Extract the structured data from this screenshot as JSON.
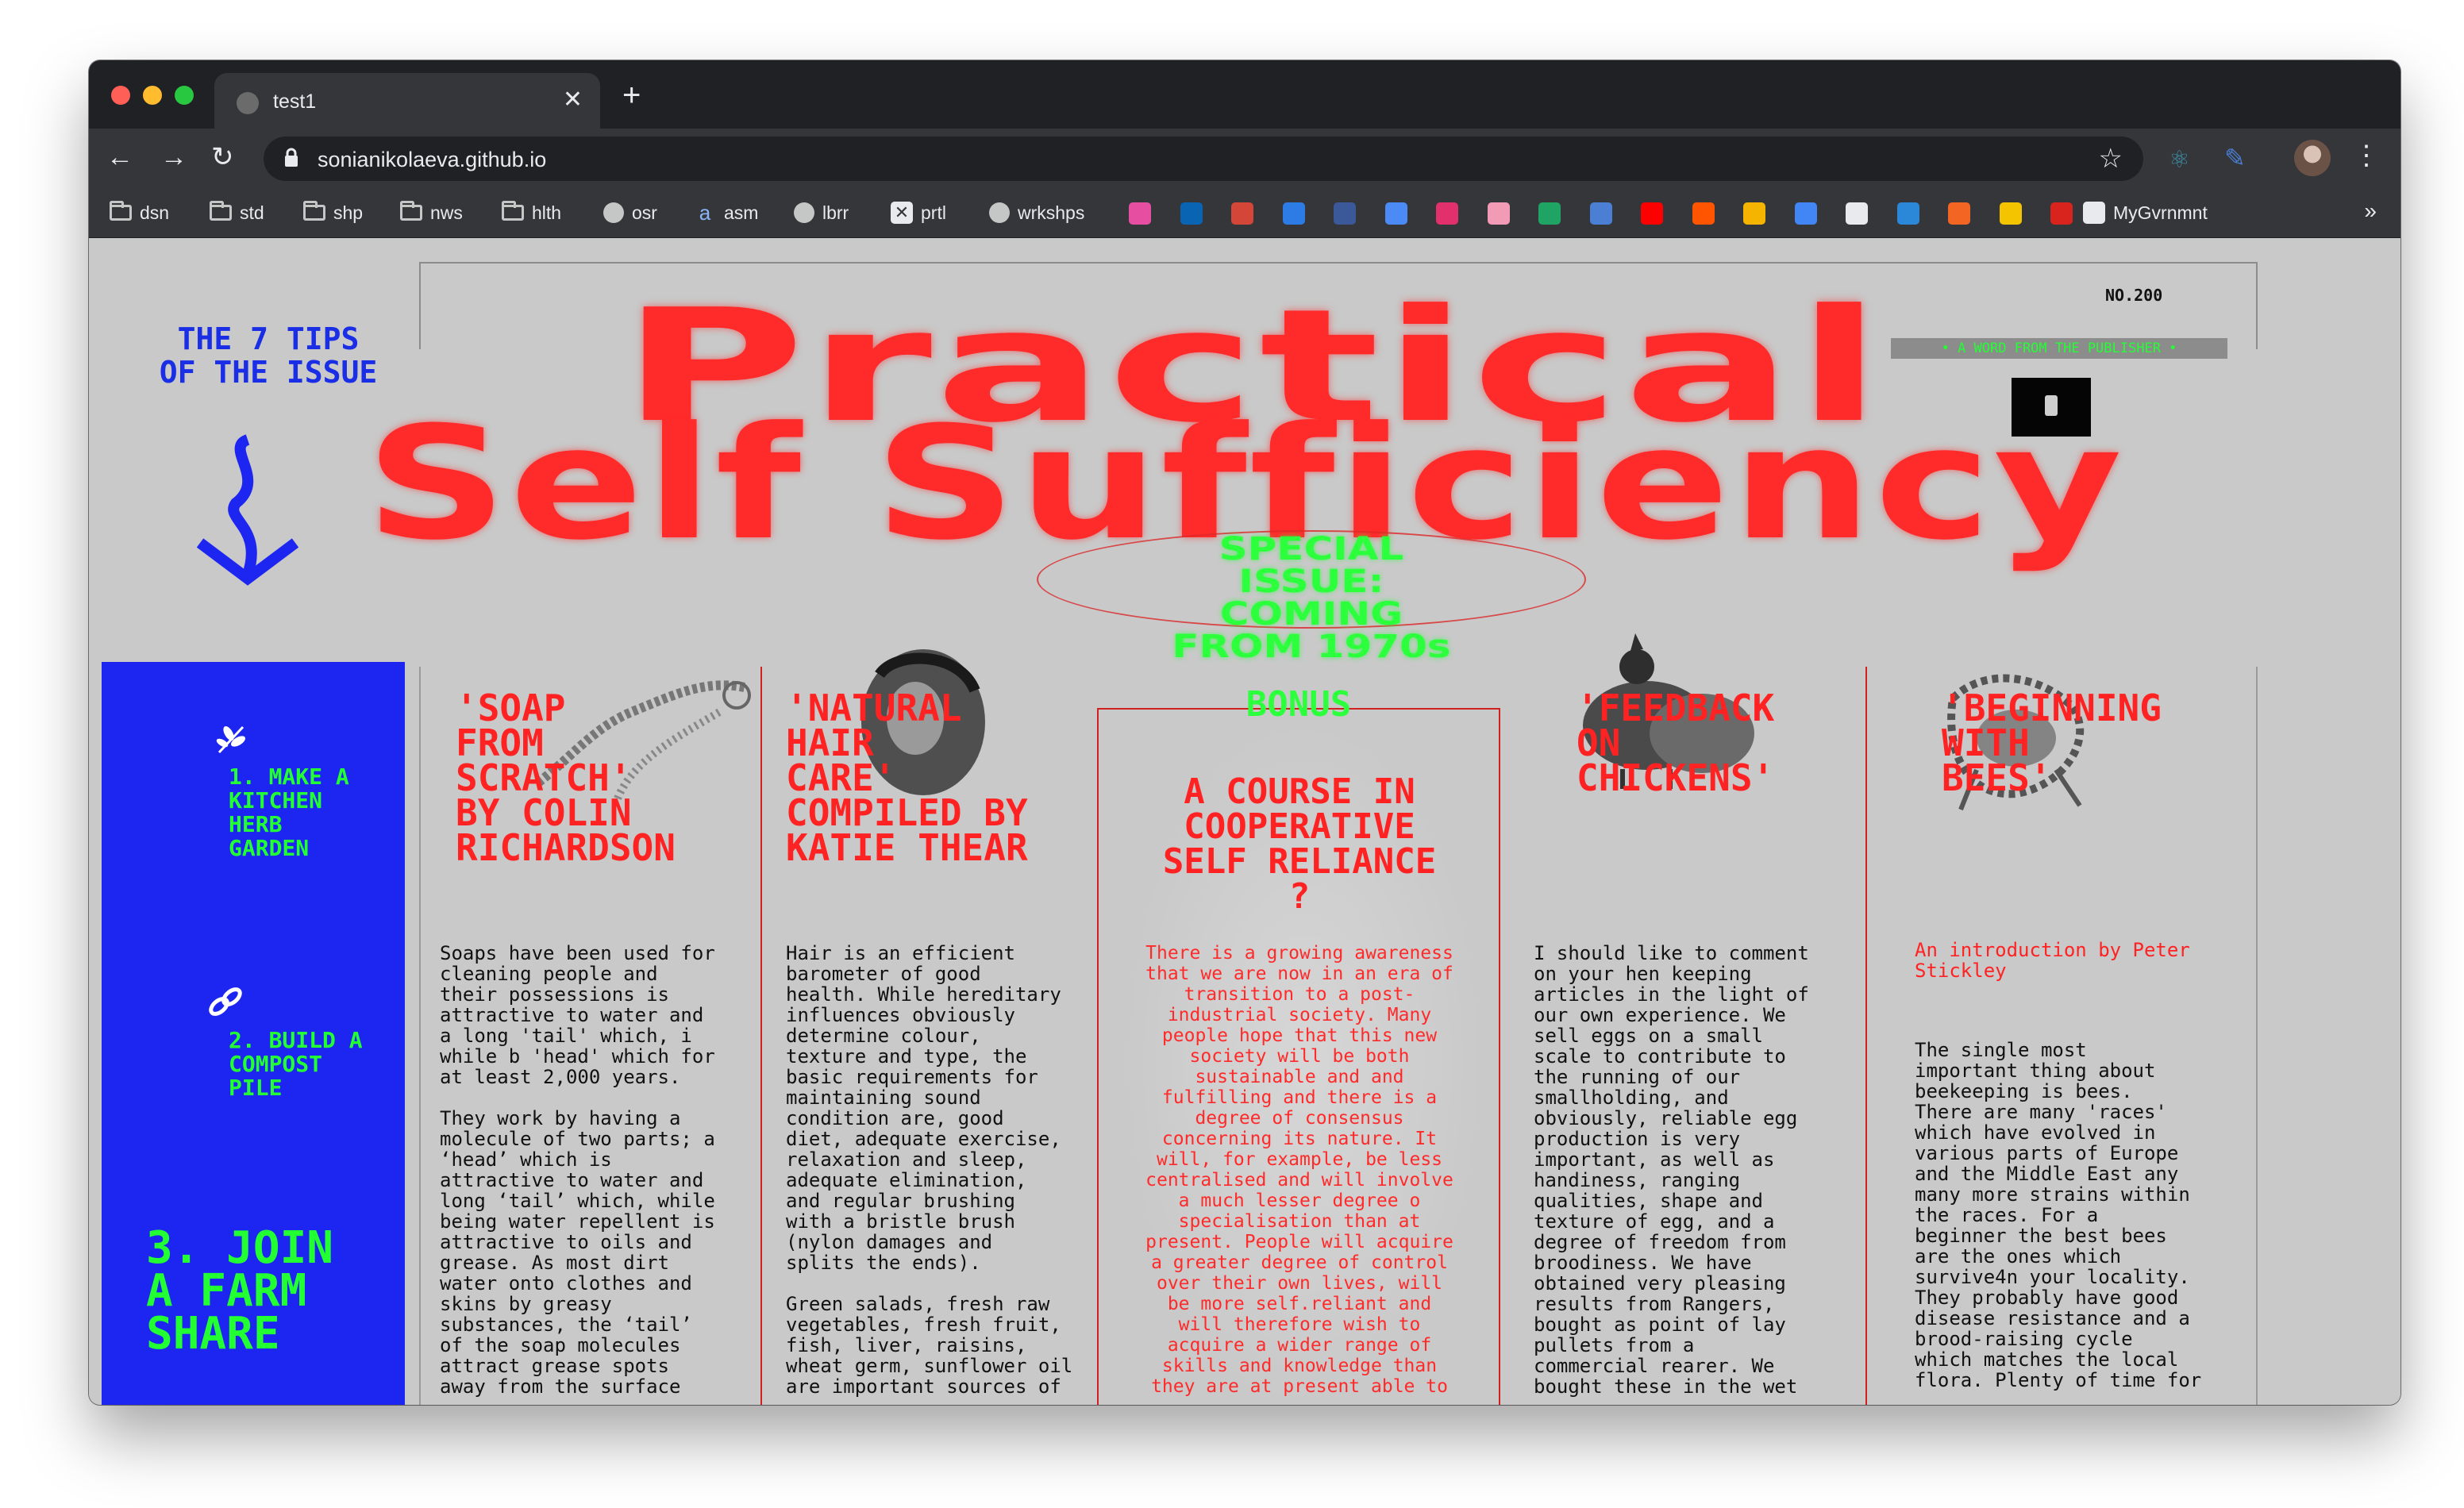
{
  "browser": {
    "tab_title": "test1",
    "url": "sonianikolaeva.github.io",
    "tab_close": "✕",
    "new_tab": "+",
    "back": "←",
    "forward": "→",
    "reload": "↻",
    "star": "☆",
    "menu": "⋮",
    "more": "»",
    "bookmarks": [
      {
        "label": "dsn",
        "icon": "folder-icon"
      },
      {
        "label": "std",
        "icon": "folder-icon"
      },
      {
        "label": "shp",
        "icon": "folder-icon"
      },
      {
        "label": "nws",
        "icon": "folder-icon"
      },
      {
        "label": "hlth",
        "icon": "folder-icon"
      },
      {
        "label": "osr",
        "icon": "globe-icon"
      },
      {
        "label": "asm",
        "icon": "a-icon"
      },
      {
        "label": "lbrr",
        "icon": "globe-icon"
      },
      {
        "label": "prtl",
        "icon": "x-icon"
      },
      {
        "label": "wrkshps",
        "icon": "globe-icon"
      },
      {
        "label": "MyGvrnmnt",
        "icon": "gov-icon"
      }
    ],
    "favicon_colors": [
      "#e54ea1",
      "#0a64b4",
      "#d44638",
      "#2d7be5",
      "#3b5998",
      "#4c8bf5",
      "#e1306c",
      "#f29bb7",
      "#1fa463",
      "#4a7fd4",
      "#ff0000",
      "#ff5500",
      "#f5b400",
      "#4285f4",
      "#e8eaed",
      "#2b88d8",
      "#f26522",
      "#f5c400",
      "#d9231d"
    ]
  },
  "page": {
    "tips_heading": "THE 7 TIPS\nOF THE ISSUE",
    "issue_no": "NO.200",
    "publisher_badge": "• A WORD FROM THE PUBLISHER •",
    "title_line1": "Practical",
    "title_line2": "Self Sufficiency",
    "special": "SPECIAL\nISSUE:\nCOMING\nFROM 1970s",
    "colors": {
      "red": "#ff2b2b",
      "green": "#22ff33",
      "blue": "#1d26f0",
      "bg": "#c9c9c9"
    },
    "tips": [
      {
        "text": "1. MAKE A\nKITCHEN\nHERB\nGARDEN",
        "icon": "herb-icon"
      },
      {
        "text": "2. BUILD A\nCOMPOST\nPILE",
        "icon": "chain-icon"
      },
      {
        "text": "3. JOIN\nA FARM\nSHARE"
      }
    ],
    "articles": [
      {
        "title": "'SOAP\nFROM\nSCRATCH'\nBY COLIN\nRICHARDSON",
        "body": "Soaps have been used for\ncleaning people and\ntheir possessions is\nattractive to water and\na long 'tail' which, i\nwhile b 'head' which for\nat least 2,000 years.\n\nThey work by having a\nmolecule of two parts; a\n‘head’ which is\nattractive to water and\nlong ‘tail’ which, while\nbeing water repellent is\nattractive to oils and\ngrease. As most dirt\nwater onto clothes and\nskins by greasy\nsubstances, the ‘tail’\nof the soap molecules\nattract grease spots\naway from the surface"
      },
      {
        "title": "'NATURAL\nHAIR\nCARE'\nCOMPILED BY\nKATIE THEAR",
        "body": "Hair is an efficient\nbarometer of good\nhealth. While hereditary\ninfluences obviously\ndetermine colour,\ntexture and type, the\nbasic requirements for\nmaintaining sound\ncondition are, good\ndiet, adequate exercise,\nrelaxation and sleep,\nadequate elimination,\nand regular brushing\nwith a bristle brush\n(nylon damages and\nsplits the ends).\n\nGreen salads, fresh raw\nvegetables, fresh fruit,\nfish, liver, raisins,\nwheat germ, sunflower oil\nare important sources of"
      },
      {
        "label": "BONUS",
        "title": "A COURSE IN\nCOOPERATIVE\nSELF RELIANCE\n?",
        "body": "There is a growing awareness\nthat we are now in an era of\ntransition to a post-\nindustrial society. Many\npeople hope that this new\nsociety will be both\nsustainable and and\nfulfilling and there is a\ndegree of consensus\nconcerning its nature. It\nwill, for example, be less\ncentralised and will involve\na much lesser degree o\nspecialisation than at\npresent. People will acquire\na greater degree of control\nover their own lives, will\nbe more self.reliant and\nwill therefore wish to\nacquire a wider range of\nskills and knowledge than\nthey are at present able to"
      },
      {
        "title": "'FEEDBACK\nON\nCHICKENS'",
        "body": "I should like to comment\non your hen keeping\narticles in the light of\nour own experience. We\nsell eggs on a small\nscale to contribute to\nthe running of our\nsmallholding, and\nobviously, reliable egg\nproduction is very\nimportant, as well as\nhandiness, ranging\nqualities, shape and\ntexture of egg, and a\ndegree of freedom from\nbroodiness. We have\nobtained very pleasing\nresults from Rangers,\nbought as point of lay\npullets from a\ncommercial rearer. We\nbought these in the wet"
      },
      {
        "title": "'BEGINNING\nWITH\nBEES'",
        "subtitle": "An introduction by Peter\nStickley",
        "body": "The single most\nimportant thing about\nbeekeeping is bees.\nThere are many 'races'\nwhich have evolved in\nvarious parts of Europe\nand the Middle East any\nmany more strains within\nthe races. For a\nbeginner the best bees\nare the ones which\nsurvive4n your locality.\nThey probably have good\ndisease resistance and a\nbrood-raising cycle\nwhich matches the local\nflora. Plenty of time for"
      }
    ]
  }
}
